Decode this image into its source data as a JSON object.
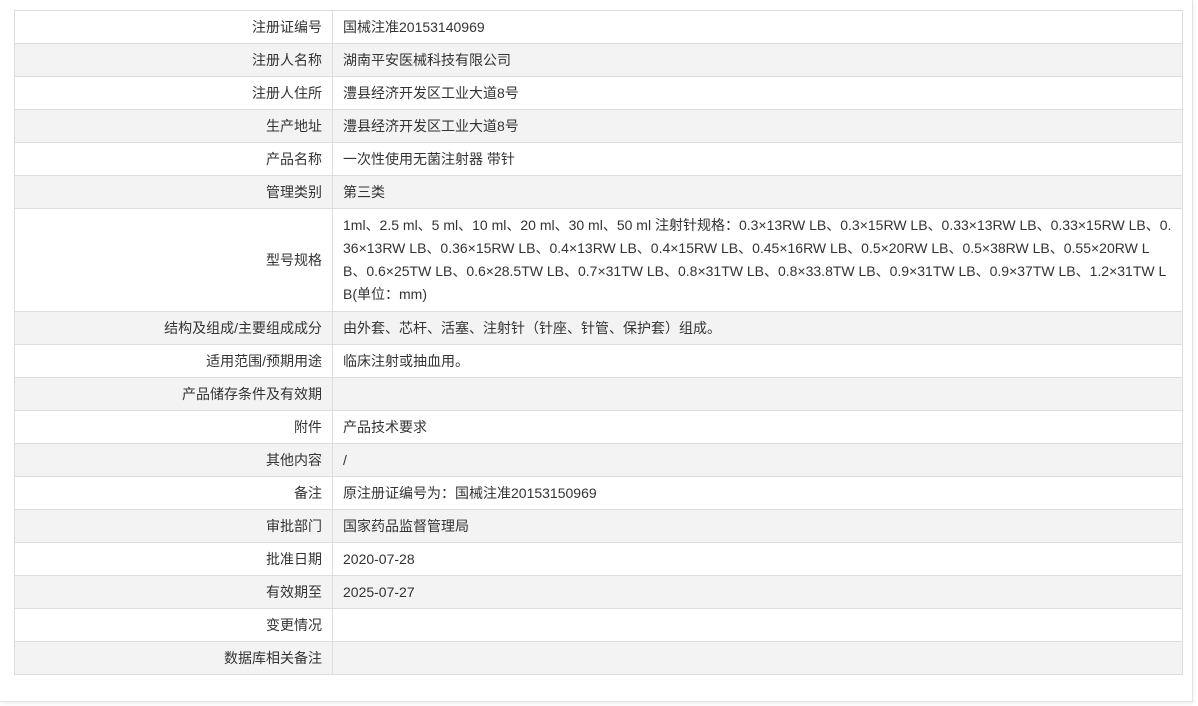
{
  "rows": [
    {
      "label": "注册证编号",
      "value": "国械注准20153140969"
    },
    {
      "label": "注册人名称",
      "value": "湖南平安医械科技有限公司"
    },
    {
      "label": "注册人住所",
      "value": "澧县经济开发区工业大道8号"
    },
    {
      "label": "生产地址",
      "value": "澧县经济开发区工业大道8号"
    },
    {
      "label": "产品名称",
      "value": "一次性使用无菌注射器 带针"
    },
    {
      "label": "管理类别",
      "value": "第三类"
    },
    {
      "label": "型号规格",
      "value": "1ml、2.5 ml、5 ml、10 ml、20 ml、30 ml、50 ml 注射针规格：0.3×13RW LB、0.3×15RW LB、0.33×13RW LB、0.33×15RW LB、0.36×13RW LB、0.36×15RW LB、0.4×13RW LB、0.4×15RW LB、0.45×16RW LB、0.5×20RW LB、0.5×38RW LB、0.55×20RW LB、0.6×25TW LB、0.6×28.5TW LB、0.7×31TW LB、0.8×31TW LB、0.8×33.8TW LB、0.9×31TW LB、0.9×37TW LB、1.2×31TW LB(单位：mm)"
    },
    {
      "label": "结构及组成/主要组成成分",
      "value": "由外套、芯杆、活塞、注射针（针座、针管、保护套）组成。"
    },
    {
      "label": "适用范围/预期用途",
      "value": "临床注射或抽血用。"
    },
    {
      "label": "产品储存条件及有效期",
      "value": ""
    },
    {
      "label": "附件",
      "value": "产品技术要求"
    },
    {
      "label": "其他内容",
      "value": "/"
    },
    {
      "label": "备注",
      "value": "原注册证编号为：国械注准20153150969"
    },
    {
      "label": "审批部门",
      "value": "国家药品监督管理局"
    },
    {
      "label": "批准日期",
      "value": "2020-07-28"
    },
    {
      "label": "有效期至",
      "value": "2025-07-27"
    },
    {
      "label": "变更情况",
      "value": ""
    },
    {
      "label": "数据库相关备注",
      "value": ""
    }
  ],
  "colors": {
    "text": "#333333",
    "border": "#dddddd",
    "row": "#ffffff",
    "row_alt": "#f3f3f3"
  }
}
